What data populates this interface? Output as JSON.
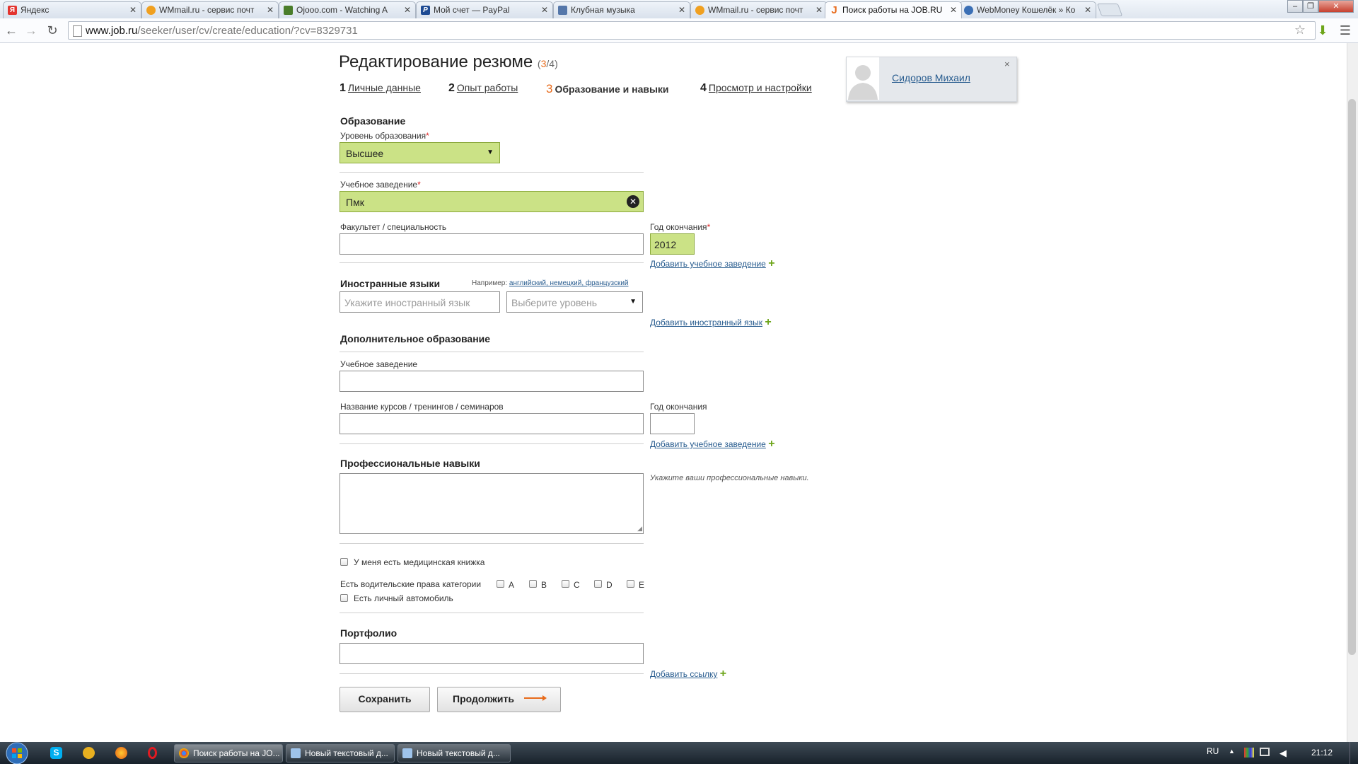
{
  "browser": {
    "tabs": [
      {
        "label": "Яндекс",
        "icon": "yandex-favicon",
        "color": "#e3342f"
      },
      {
        "label": "WMmail.ru - сервис почт",
        "icon": "wmmail-favicon",
        "color": "#f0a020"
      },
      {
        "label": "Ojooo.com - Watching A",
        "icon": "ojooo-favicon",
        "color": "#4a7d2a"
      },
      {
        "label": "Мой счет — PayPal",
        "icon": "paypal-favicon",
        "color": "#1e4b93"
      },
      {
        "label": "Клубная музыка",
        "icon": "music-favicon",
        "color": "#5577aa"
      },
      {
        "label": "WMmail.ru - сервис почт",
        "icon": "wmmail-favicon",
        "color": "#f0a020"
      },
      {
        "label": "Поиск работы на JOB.RU",
        "icon": "jobru-favicon",
        "color": "#e86a1a"
      },
      {
        "label": "WebMoney Кошелёк » Ко",
        "icon": "webmoney-favicon",
        "color": "#3a6fb5"
      }
    ],
    "url_host": "www.job.ru",
    "url_path": "/seeker/user/cv/create/education/?cv=8329731"
  },
  "page": {
    "title": "Редактирование резюме",
    "step_current": "3",
    "step_total": "/4",
    "steps": [
      {
        "num": "1",
        "label": "Личные данные"
      },
      {
        "num": "2",
        "label": "Опыт работы"
      },
      {
        "num": "3",
        "label": "Образование и навыки"
      },
      {
        "num": "4",
        "label": "Просмотр и настройки"
      }
    ],
    "education": {
      "heading": "Образование",
      "level_label": "Уровень образования",
      "level_value": "Высшее",
      "institution_label": "Учебное заведение",
      "institution_value": "Пмк",
      "faculty_label": "Факультет / специальность",
      "faculty_value": "",
      "year_label": "Год окончания",
      "year_value": "2012",
      "add_link": "Добавить учебное заведение"
    },
    "languages": {
      "heading": "Иностранные языки",
      "example_prefix": "Например:",
      "examples": "английский, немецкий, французский",
      "language_placeholder": "Укажите иностранный язык",
      "level_placeholder": "Выберите уровень",
      "add_link": "Добавить иностранный язык"
    },
    "additional": {
      "heading": "Дополнительное образование",
      "institution_label": "Учебное заведение",
      "courses_label": "Название курсов / тренингов / семинаров",
      "year_label": "Год окончания",
      "add_link": "Добавить учебное заведение"
    },
    "skills": {
      "heading": "Профессиональные навыки",
      "hint": "Укажите ваши профессиональные навыки."
    },
    "checks": {
      "medical": "У меня есть медицинская книжка",
      "license_label": "Есть водительские права категории",
      "categories": [
        "A",
        "B",
        "C",
        "D",
        "E"
      ],
      "car": "Есть личный автомобиль"
    },
    "portfolio": {
      "heading": "Портфолио",
      "add_link": "Добавить ссылку"
    },
    "buttons": {
      "save": "Сохранить",
      "continue": "Продолжить"
    },
    "profile": {
      "name": "Сидоров Михаил",
      "close": "×"
    }
  },
  "taskbar": {
    "items": [
      {
        "label": "Поиск работы на JO...",
        "icon": "chrome-icon"
      },
      {
        "label": "Новый текстовый д...",
        "icon": "notepad-icon"
      },
      {
        "label": "Новый текстовый д...",
        "icon": "notepad-icon"
      }
    ],
    "lang": "RU",
    "time": "21:12"
  }
}
